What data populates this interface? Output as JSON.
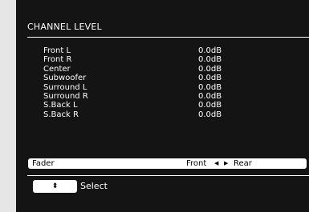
{
  "screen": {
    "title": "CHANNEL LEVEL",
    "channels": [
      {
        "label": "Front L",
        "value": "0.0dB"
      },
      {
        "label": "Front R",
        "value": "0.0dB"
      },
      {
        "label": "Center",
        "value": "0.0dB"
      },
      {
        "label": "Subwoofer",
        "value": "0.0dB"
      },
      {
        "label": "Surround L",
        "value": "0.0dB"
      },
      {
        "label": "Surround R",
        "value": "0.0dB"
      },
      {
        "label": "S.Back L",
        "value": "0.0dB"
      },
      {
        "label": "S.Back R",
        "value": "0.0dB"
      }
    ],
    "fader": {
      "label": "Fader",
      "front": "Front",
      "rear": "Rear",
      "arrow_left": "◀",
      "arrow_right": "▶"
    },
    "footer": {
      "key_icon": "⬍",
      "select_label": "Select"
    }
  }
}
